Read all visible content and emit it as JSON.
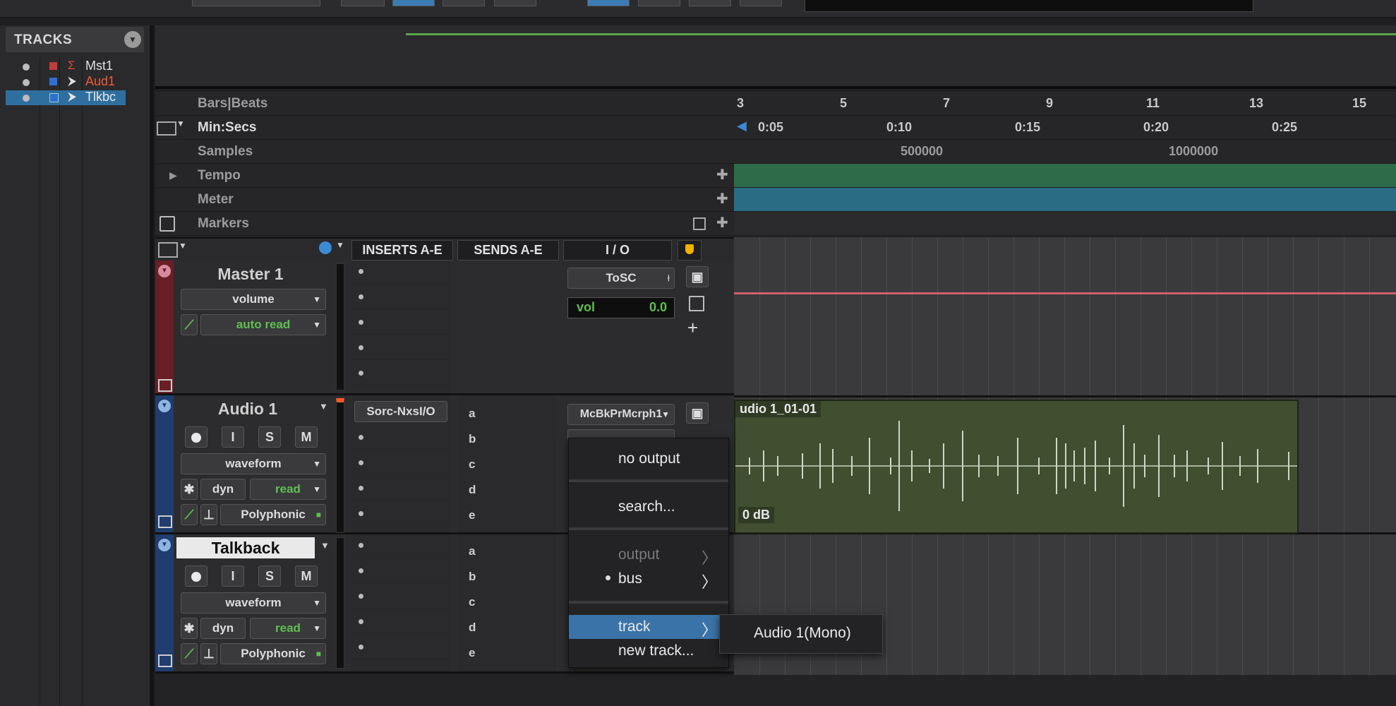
{
  "tracks_panel": {
    "title": "TRACKS",
    "items": [
      {
        "name": "Mst1",
        "color": "#c23b3b",
        "glyph": "Σ",
        "name_color": "#e0e0e0",
        "selected": false
      },
      {
        "name": "Aud1",
        "color": "#2f6fd1",
        "glyph": "⮞",
        "name_color": "#ef5a3a",
        "selected": false
      },
      {
        "name": "Tlkbc",
        "color": "#2f6fd1",
        "glyph": "⮞",
        "name_color": "#e8e8e8",
        "selected": true
      }
    ]
  },
  "rulers": {
    "bars_beats": "Bars|Beats",
    "min_secs": "Min:Secs",
    "samples": "Samples",
    "tempo": "Tempo",
    "meter": "Meter",
    "markers": "Markers",
    "bars_ticks": [
      "3",
      "5",
      "7",
      "9",
      "11",
      "13",
      "15"
    ],
    "secs_ticks": [
      "0:05",
      "0:10",
      "0:15",
      "0:20",
      "0:25"
    ],
    "sample_ticks": [
      "500000",
      "1000000"
    ]
  },
  "mix_columns": {
    "inserts": "INSERTS A-E",
    "sends": "SENDS A-E",
    "io": "I / O"
  },
  "master": {
    "name": "Master 1",
    "view": "volume",
    "automation": "auto read",
    "output": "ToSC",
    "vol_label": "vol",
    "vol_value": "0.0"
  },
  "audio1": {
    "name": "Audio 1",
    "view": "waveform",
    "dyn": "dyn",
    "read": "read",
    "mode": "Polyphonic",
    "insert": "Sorc-NxsI/O",
    "input": "McBkPrMcrph1",
    "sends": [
      "a",
      "b",
      "c",
      "d",
      "e"
    ],
    "clip_name": "udio 1_01-01",
    "clip_gain": "0 dB"
  },
  "talkback": {
    "name": "Talkback",
    "view": "waveform",
    "dyn": "dyn",
    "read": "read",
    "mode": "Polyphonic",
    "sends": [
      "a",
      "b",
      "c",
      "d",
      "e"
    ]
  },
  "buttons": {
    "I": "I",
    "S": "S",
    "M": "M"
  },
  "popup_menu": {
    "no_output": "no output",
    "search": "search...",
    "output": "output",
    "bus": "bus",
    "track": "track",
    "new_track": "new track...",
    "arrow": "〉"
  },
  "submenu": {
    "item": "Audio 1(Mono)"
  },
  "colors": {
    "accent": "#3a73a8",
    "clip": "#3f4f30",
    "tempo": "#2e6b48",
    "meter": "#2b6c85"
  }
}
